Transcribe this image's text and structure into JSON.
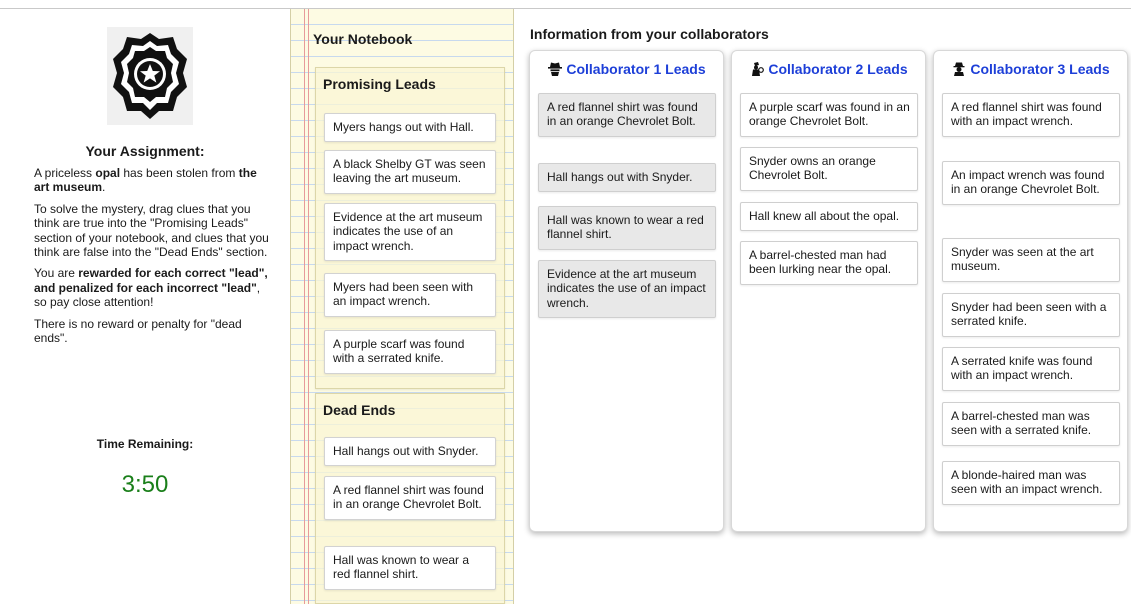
{
  "assignment": {
    "title": "Your Assignment:",
    "p1_pre": "A priceless ",
    "p1_item": "opal",
    "p1_mid": " has been stolen from ",
    "p1_place": "the art museum",
    "p1_end": ".",
    "p2": "To solve the mystery, drag clues that you think are true into the \"Promising Leads\" section of your notebook, and clues that you think are false into the \"Dead Ends\" section.",
    "p3_pre": "You are ",
    "p3_bold": "rewarded for each correct \"lead\", and penalized for each incorrect \"lead\"",
    "p3_end": ", so pay close attention!",
    "p4": "There is no reward or penalty for \"dead ends\".",
    "time_label": "Time Remaining:",
    "time_value": "3:50",
    "icon": "police-badge-icon"
  },
  "notebook": {
    "title": "Your Notebook",
    "promising": {
      "title": "Promising Leads",
      "items": [
        "Myers hangs out with Hall.",
        "A black Shelby GT was seen leaving the art museum.",
        "Evidence at the art museum indicates the use of an impact wrench.",
        "Myers had been seen with an impact wrench.",
        "A purple scarf was found with a serrated knife."
      ]
    },
    "dead_ends": {
      "title": "Dead Ends",
      "items": [
        "Hall hangs out with Snyder.",
        "A red flannel shirt was found in an orange Chevrolet Bolt.",
        "Hall was known to wear a red flannel shirt."
      ]
    }
  },
  "collaborators": {
    "title": "Information from your collaborators",
    "columns": [
      {
        "name": "Collaborator 1 Leads",
        "icon": "spy-fedora-icon",
        "items": [
          "A red flannel shirt was found in an orange Chevrolet Bolt.",
          "Hall hangs out with Snyder.",
          "Hall was known to wear a red flannel shirt.",
          "Evidence at the art museum indicates the use of an impact wrench."
        ]
      },
      {
        "name": "Collaborator 2 Leads",
        "icon": "detective-magnifier-icon",
        "items": [
          "A purple scarf was found in an orange Chevrolet Bolt.",
          "Snyder owns an orange Chevrolet Bolt.",
          "Hall knew all about the opal.",
          "A barrel-chested man had been lurking near the opal."
        ]
      },
      {
        "name": "Collaborator 3 Leads",
        "icon": "detective-silhouette-icon",
        "items": [
          "A red flannel shirt was found with an impact wrench.",
          "An impact wrench was found in an orange Chevrolet Bolt.",
          "Snyder was seen at the art museum.",
          "Snyder had been seen with a serrated knife.",
          "A serrated knife was found with an impact wrench.",
          "A barrel-chested man was seen with a serrated knife.",
          "A blonde-haired man was seen with an impact wrench."
        ]
      }
    ],
    "grey_card_color": "#e8e8e8",
    "header_color": "#1d3fd8"
  }
}
